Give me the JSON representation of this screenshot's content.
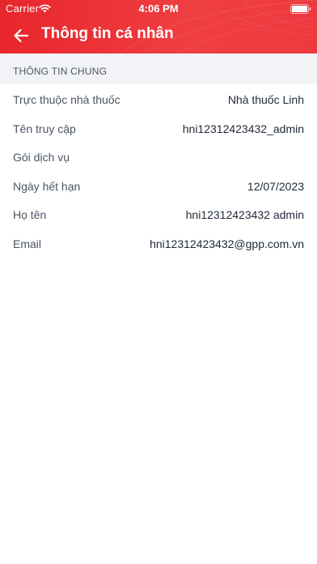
{
  "status_bar": {
    "carrier": "Carrier",
    "time": "4:06 PM"
  },
  "nav": {
    "title": "Thông tin cá nhân",
    "back_icon": "arrow-left-icon"
  },
  "section": {
    "title": "THÔNG TIN CHUNG"
  },
  "rows": [
    {
      "label": "Trực thuộc nhà thuốc",
      "value": "Nhà thuốc Linh"
    },
    {
      "label": "Tên truy cập",
      "value": "hni12312423432_admin"
    },
    {
      "label": "Gói dịch vụ",
      "value": ""
    },
    {
      "label": "Ngày hết hạn",
      "value": "12/07/2023"
    },
    {
      "label": "Họ tên",
      "value": "hni12312423432 admin"
    },
    {
      "label": "Email",
      "value": "hni12312423432@gpp.com.vn"
    }
  ],
  "colors": {
    "header": "#ee3a3f",
    "section_bg": "#f2f3f7",
    "label": "#4b5563",
    "value": "#1f2937"
  }
}
